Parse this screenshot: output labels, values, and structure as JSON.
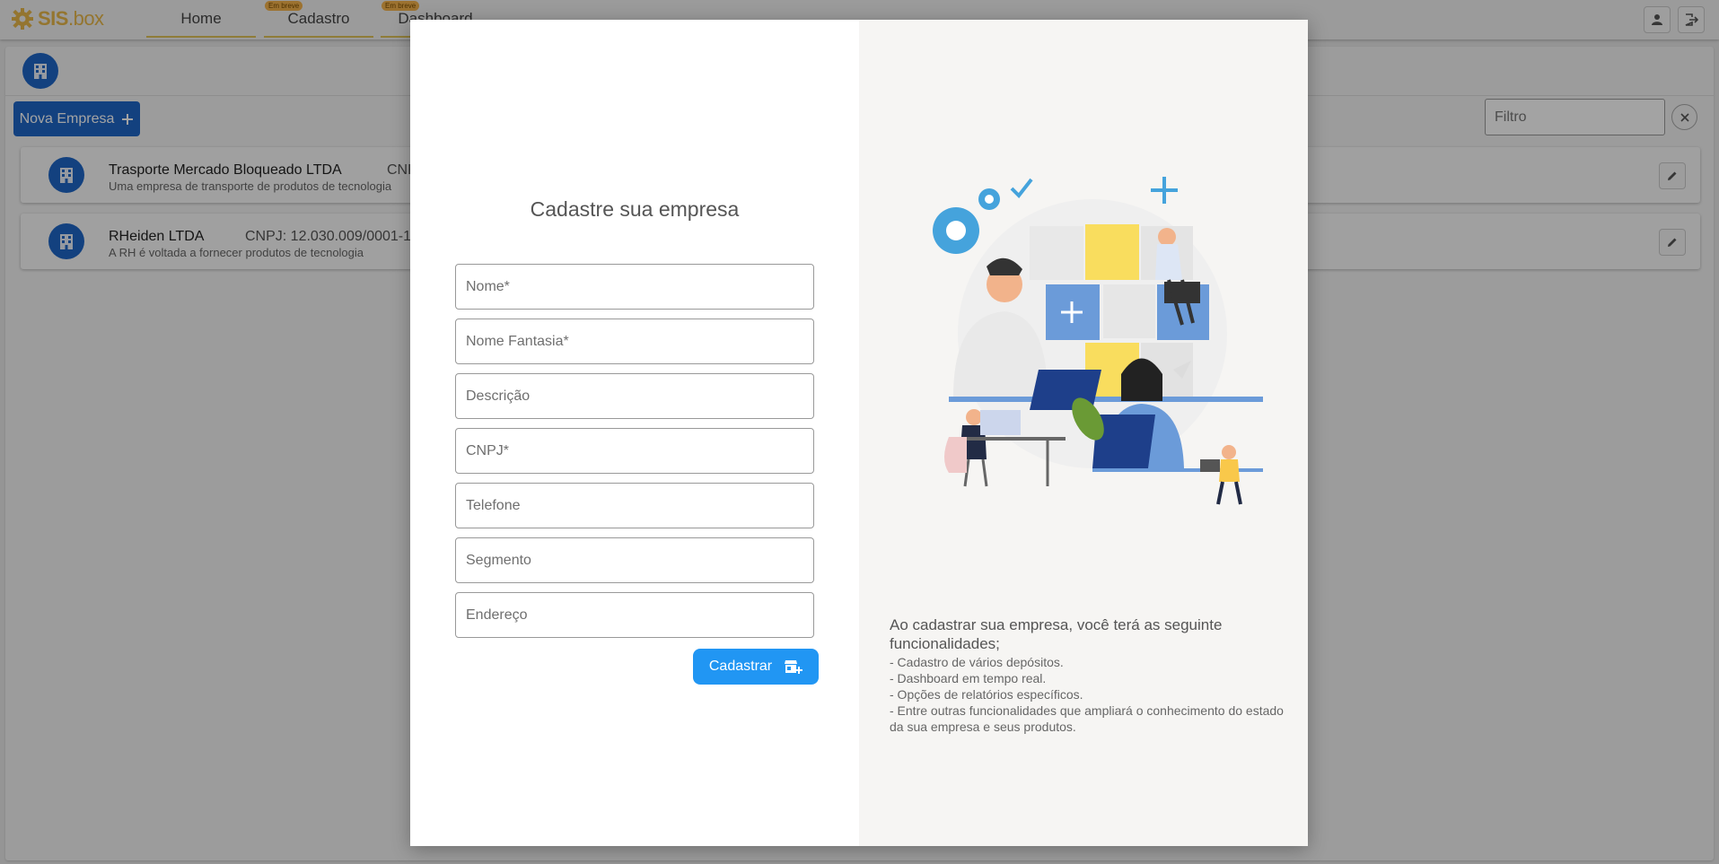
{
  "app": {
    "logo_text": "SIS",
    "logo_suffix": ".box",
    "nav": [
      {
        "label": "Home",
        "badge": ""
      },
      {
        "label": "Cadastro",
        "badge": "Em breve"
      },
      {
        "label": "Dashboard",
        "badge": "Em breve"
      }
    ]
  },
  "toolbar": {
    "new_button_label": "Nova Empresa",
    "filter_placeholder": "Filtro"
  },
  "companies": [
    {
      "name": "Trasporte Mercado Bloqueado  LTDA",
      "cnpj": "CNPJ",
      "description": "Uma empresa de transporte de produtos de tecnologia"
    },
    {
      "name": "RHeiden LTDA",
      "cnpj": "CNPJ: 12.030.009/0001-1",
      "description": "A RH é voltada a fornecer produtos de tecnologia"
    }
  ],
  "modal": {
    "title": "Cadastre sua empresa",
    "fields": {
      "nome": "Nome*",
      "nome_fantasia": "Nome Fantasia*",
      "descricao": "Descrição",
      "cnpj": "CNPJ*",
      "telefone": "Telefone",
      "segmento": "Segmento",
      "endereco": "Endereço"
    },
    "submit_label": "Cadastrar",
    "info_title": "Ao cadastrar sua empresa, você terá as seguinte funcionalidades;",
    "info_items": [
      " - Cadastro de vários depósitos.",
      " - Dashboard em tempo real.",
      " - Opções de relatórios específicos.",
      " - Entre outras funcionalidades que ampliará o conhecimento do estado da sua empresa e seus produtos."
    ]
  },
  "colors": {
    "primary": "#1e66c7",
    "submit": "#2196f3",
    "logo": "#e8b84a",
    "right_panel": "#f6f5f3"
  }
}
